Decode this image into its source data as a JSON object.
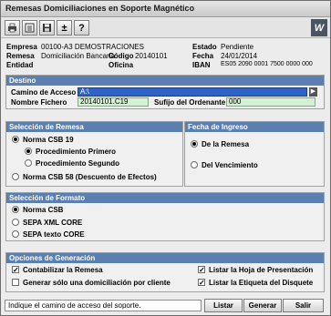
{
  "window": {
    "title": "Remesas Domiciliaciones en Soporte Magnético",
    "logo_text": "W"
  },
  "toolbar": {
    "icons": [
      "print-icon",
      "document-icon",
      "save-icon",
      "plus-minus-icon",
      "help-icon"
    ],
    "plus_minus": "±",
    "help": "?"
  },
  "header": {
    "empresa_label": "Empresa",
    "empresa_value": "00100-A3 DEMOSTRACIONES",
    "remesa_label": "Remesa",
    "remesa_value": "Domiciliación Bancaria",
    "codigo_label": "Código",
    "codigo_value": "20140101",
    "entidad_label": "Entidad",
    "oficina_label": "Oficina",
    "estado_label": "Estado",
    "estado_value": "Pendiente",
    "fecha_label": "Fecha",
    "fecha_value": "24/01/2014",
    "iban_label": "IBAN",
    "iban_value": "ES05 2090 0001 7500 0000 000"
  },
  "destino": {
    "title": "Destino",
    "camino_label": "Camino de Acceso",
    "camino_value": "A:\\",
    "nombre_label": "Nombre Fichero",
    "nombre_value": "20140101.C19",
    "sufijo_label": "Sufijo del Ordenante",
    "sufijo_value": "000"
  },
  "seleccion_remesa": {
    "title": "Selección de Remesa",
    "opt1": "Norma CSB 19",
    "sub1": "Procedimiento Primero",
    "sub2": "Procedimiento Segundo",
    "opt2": "Norma CSB 58 (Descuento de Efectos)"
  },
  "fecha_ingreso": {
    "title": "Fecha de Ingreso",
    "opt1": "De la Remesa",
    "opt2": "Del Vencimiento"
  },
  "seleccion_formato": {
    "title": "Selección de Formato",
    "opt1": "Norma CSB",
    "opt2": "SEPA XML CORE",
    "opt3": "SEPA texto CORE"
  },
  "opciones": {
    "title": "Opciones de Generación",
    "c1": "Contabilizar la Remesa",
    "c2": "Generar sólo una domiciliación por cliente",
    "c3": "Listar la Hoja de Presentación",
    "c4": "Listar la Etiqueta del Disquete"
  },
  "status": {
    "text": "Indique el camino de acceso del soporte."
  },
  "buttons": {
    "listar": "Listar",
    "generar": "Generar",
    "salir": "Salir"
  }
}
